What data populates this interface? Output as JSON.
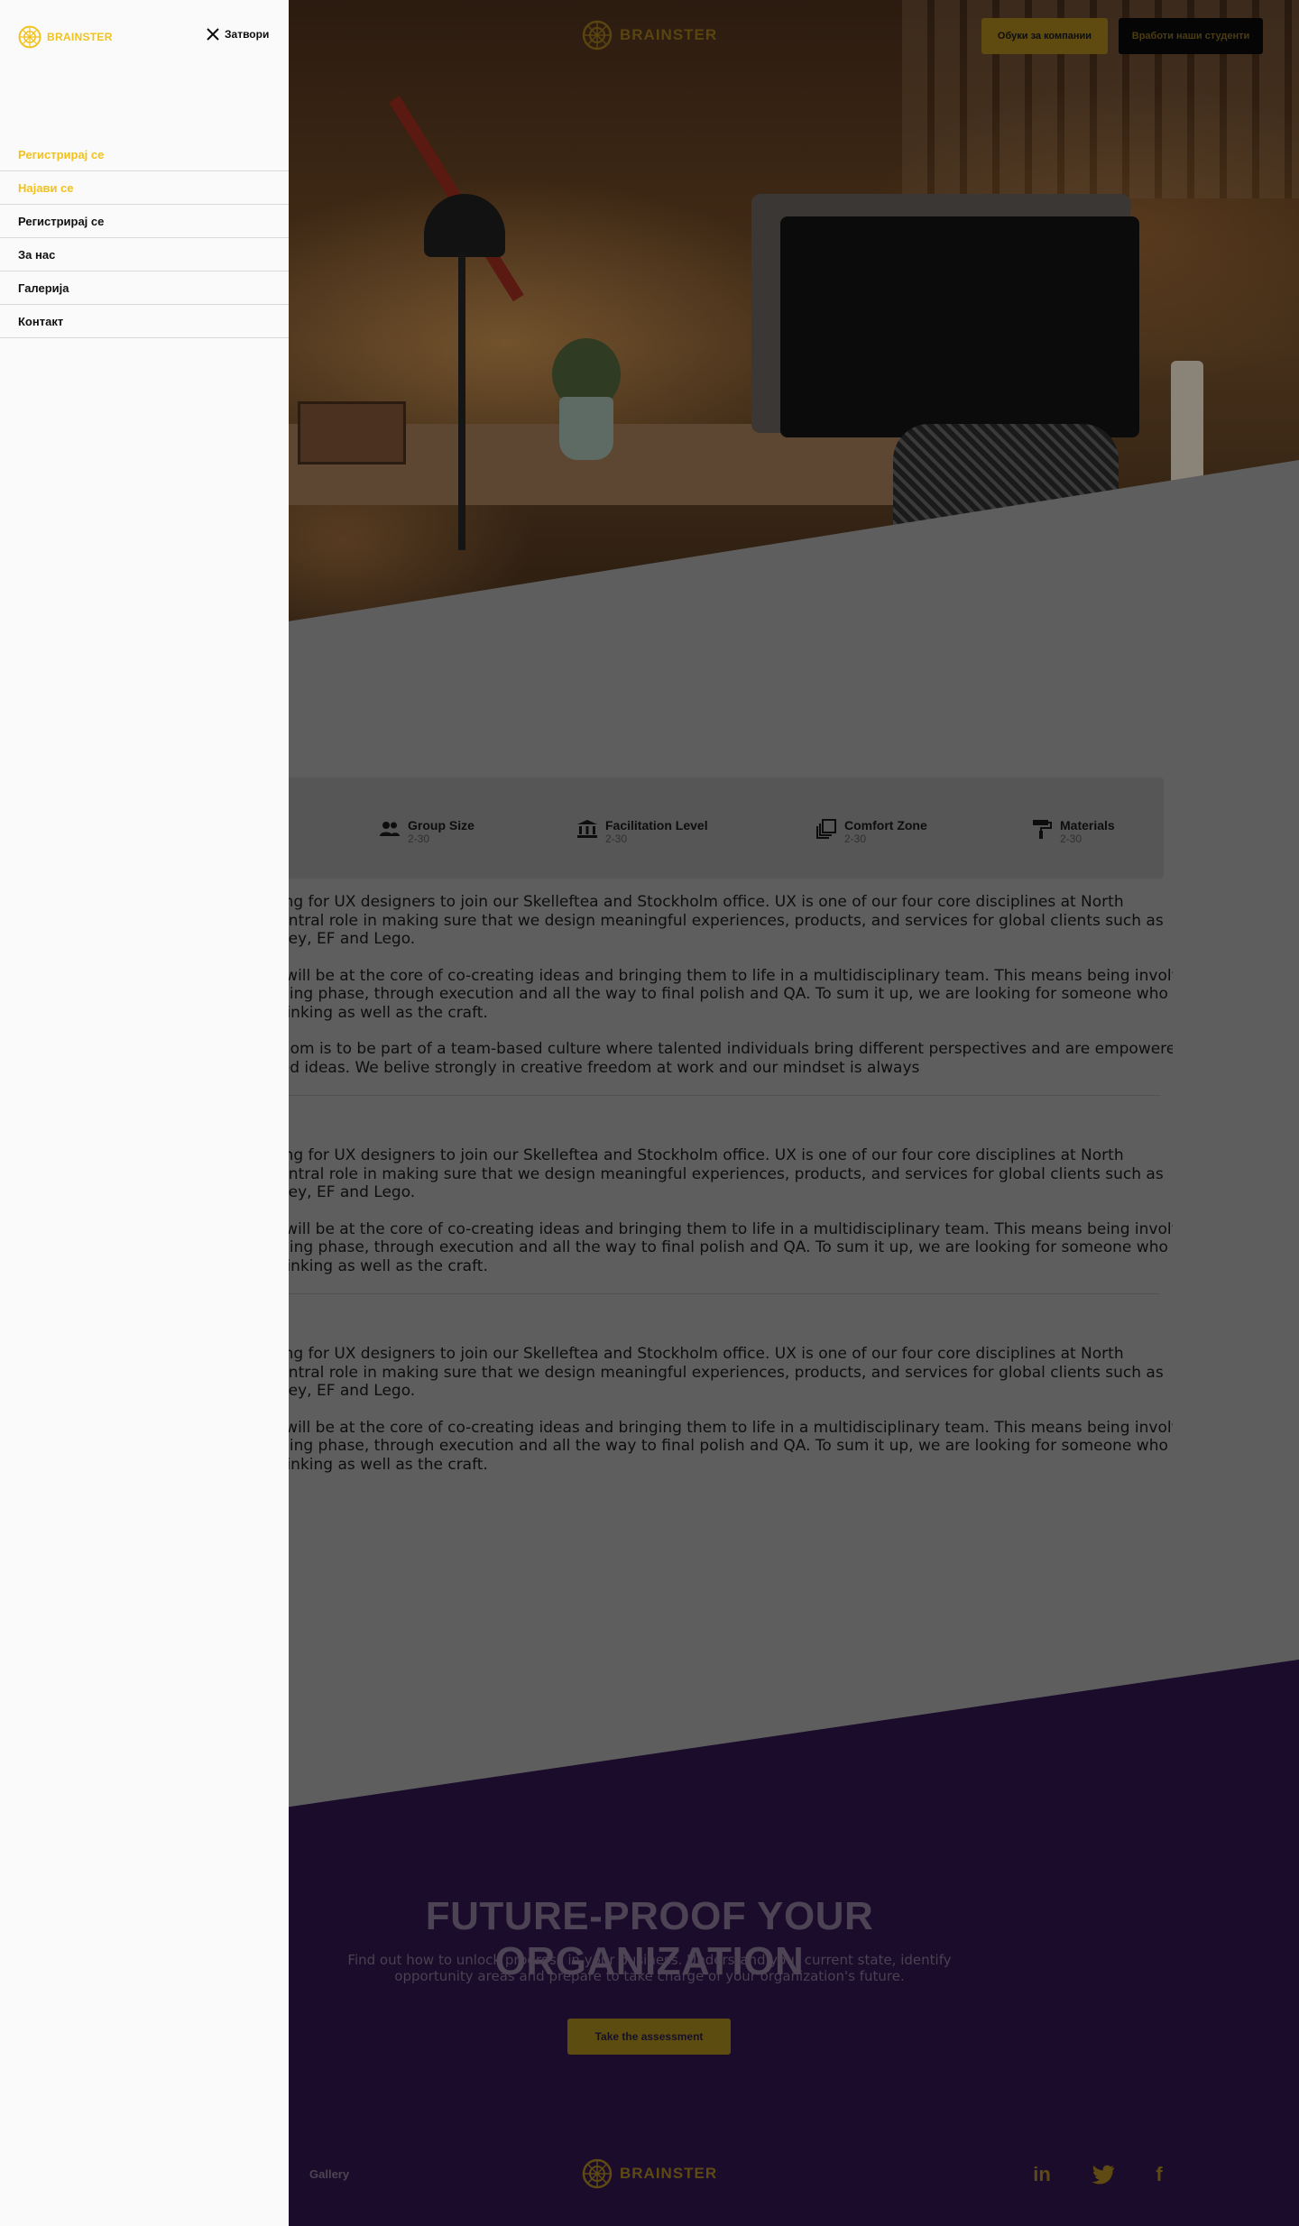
{
  "header": {
    "brand": "BRAINSTER",
    "companies_button": "Обуки за компании",
    "students_button": "Вработи наши студенти"
  },
  "drawer": {
    "brand": "BRAINSTER",
    "close_label": "Затвори",
    "items": [
      {
        "label": "Регистрирај се",
        "highlighted": true
      },
      {
        "label": "Најави се",
        "highlighted": true
      },
      {
        "label": "Регистрирај се",
        "highlighted": false
      },
      {
        "label": "За нас",
        "highlighted": false
      },
      {
        "label": "Галерија",
        "highlighted": false
      },
      {
        "label": "Контакт",
        "highlighted": false
      }
    ],
    "accent_color": "#f2c21b"
  },
  "info_bar": {
    "items": [
      {
        "icon": "group-icon",
        "title": "Group Size",
        "value": "2-30"
      },
      {
        "icon": "institution-icon",
        "title": "Facilitation Level",
        "value": "2-30"
      },
      {
        "icon": "layers-icon",
        "title": "Comfort Zone",
        "value": "2-30"
      },
      {
        "icon": "paint-roller-icon",
        "title": "Materials",
        "value": "2-30"
      }
    ]
  },
  "content": {
    "sections": [
      {
        "paragraphs": [
          "king for UX designers to join our Skelleftea and Stockholm office. UX is one of our four core disciplines at North",
          "central role in making sure that we design meaningful experiences, products, and services for global clients such as",
          "sney, EF and Lego.",
          "n will be at the core of co-creating ideas and bringing them to life in a multidisciplinary team. This means being involved",
          "yping phase, through execution and all the way to final polish and QA. To sum it up, we are looking for someone who is",
          "thinking as well as the craft.",
          "gdom is to be part of a team-based culture where talented individuals bring different perspectives and are empowered",
          "ned ideas. We belive strongly in creative freedom at work and our mindset is always"
        ]
      },
      {
        "paragraphs": [
          "king for UX designers to join our Skelleftea and Stockholm office. UX is one of our four core disciplines at North",
          "central role in making sure that we design meaningful experiences, products, and services for global clients such as",
          "sney, EF and Lego.",
          "n will be at the core of co-creating ideas and bringing them to life in a multidisciplinary team. This means being involved",
          "yping phase, through execution and all the way to final polish and QA. To sum it up, we are looking for someone who is",
          "thinking as well as the craft."
        ]
      },
      {
        "paragraphs": [
          "king for UX designers to join our Skelleftea and Stockholm office. UX is one of our four core disciplines at North",
          "central role in making sure that we design meaningful experiences, products, and services for global clients such as",
          "sney, EF and Lego.",
          "n will be at the core of co-creating ideas and bringing them to life in a multidisciplinary team. This means being involved",
          "yping phase, through execution and all the way to final polish and QA. To sum it up, we are looking for someone who is",
          "thinking as well as the craft."
        ]
      }
    ]
  },
  "cta": {
    "title": "FUTURE-PROOF YOUR ORGANIZATION",
    "subtitle_line1": "Find out how to unlock progress in your business. Understand your current state, identify",
    "subtitle_line2": "opportunity areas and prepare to take charge of your organization's future.",
    "button": "Take the assessment"
  },
  "footer": {
    "gallery_link": "Gallery",
    "brand": "BRAINSTER",
    "social": [
      {
        "icon": "linkedin-icon",
        "glyph": "in"
      },
      {
        "icon": "twitter-icon",
        "glyph": ""
      },
      {
        "icon": "facebook-icon",
        "glyph": "f"
      }
    ]
  }
}
